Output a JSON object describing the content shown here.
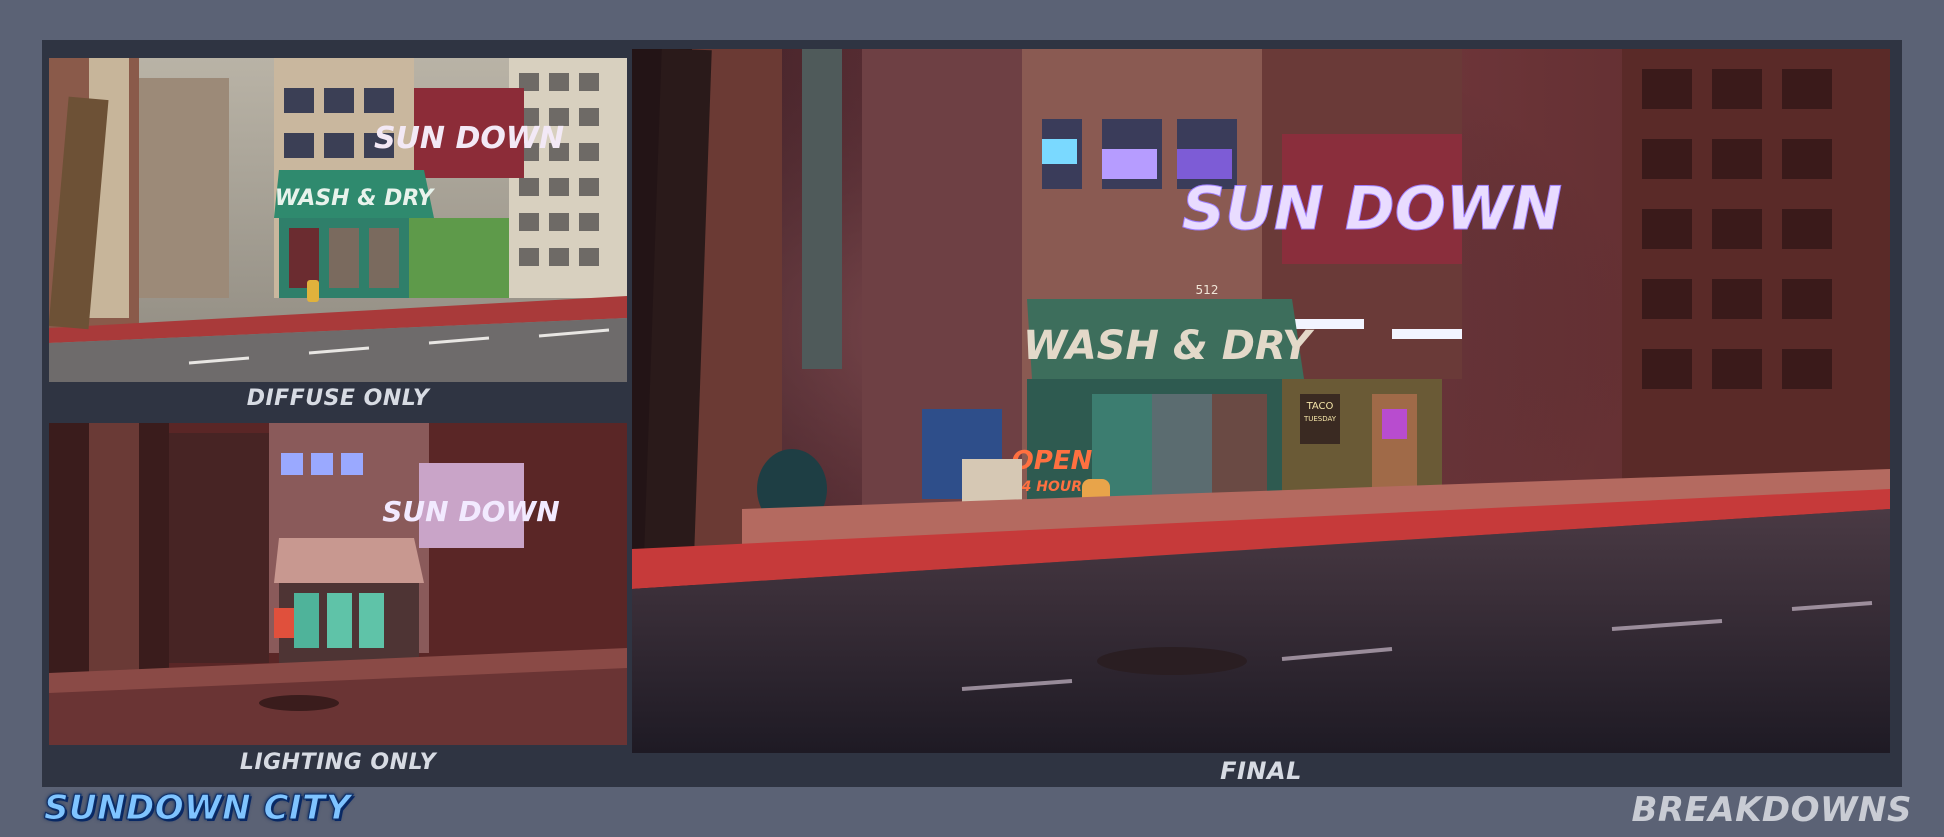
{
  "panels": {
    "diffuse": {
      "caption": "DIFFUSE ONLY"
    },
    "lighting": {
      "caption": "LIGHTING ONLY"
    },
    "final": {
      "caption": "FINAL"
    }
  },
  "scene_signs": {
    "sundown": "SUN DOWN",
    "laundromat": "WASH & DRY",
    "open": "OPEN",
    "hours": "24 HOURS",
    "taco": "TACO",
    "taco_sub": "TUESDAY",
    "address": "512"
  },
  "footer": {
    "brand": "SUNDOWN CITY",
    "section": "BREAKDOWNS"
  },
  "colors": {
    "page_background": "#5b6275",
    "frame_background": "#2f3442",
    "caption_text": "#d7dbe3",
    "brand_blue": "#7fc4ff",
    "neon_sign": "#d9c8ff",
    "awning_green": "#3d6e5c"
  }
}
